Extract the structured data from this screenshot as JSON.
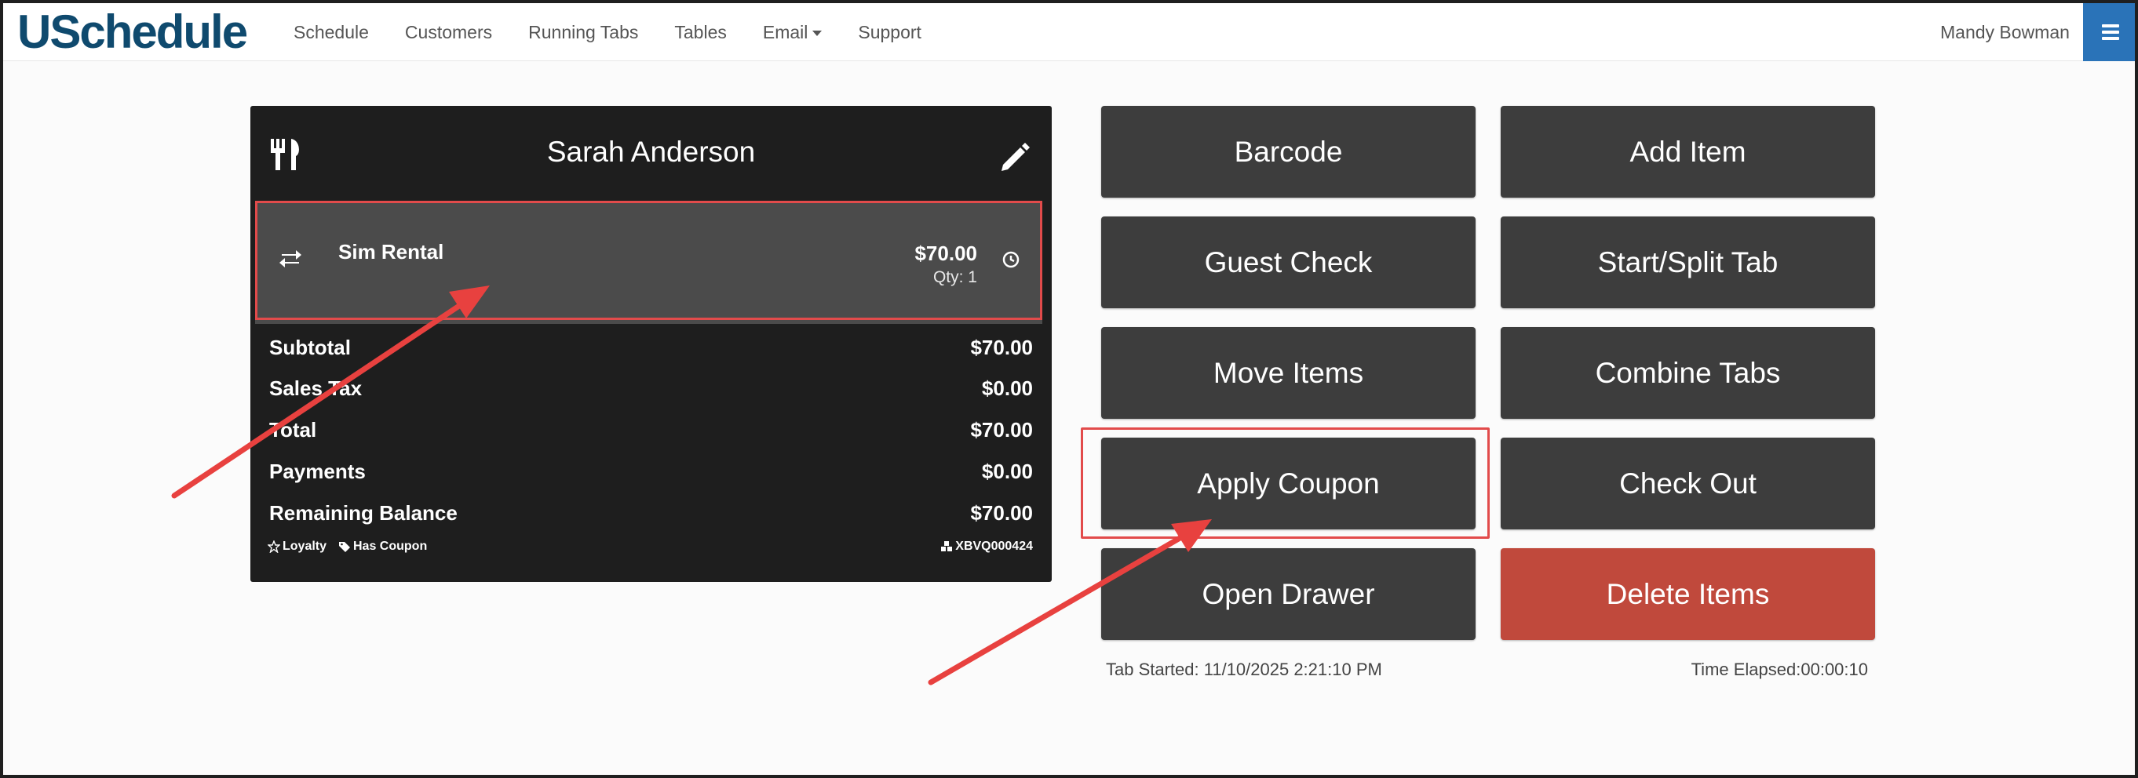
{
  "navbar": {
    "brand": "USchedule",
    "links": [
      "Schedule",
      "Customers",
      "Running Tabs",
      "Tables",
      "Email",
      "Support"
    ],
    "user": "Mandy Bowman"
  },
  "tab": {
    "customer": "Sarah Anderson",
    "item": {
      "name": "Sim Rental",
      "price": "$70.00",
      "qty": "Qty: 1"
    },
    "summary": [
      {
        "label": "Subtotal",
        "value": "$70.00"
      },
      {
        "label": "Sales Tax",
        "value": "$0.00"
      },
      {
        "label": "Total",
        "value": "$70.00"
      },
      {
        "label": "Payments",
        "value": "$0.00"
      },
      {
        "label": "Remaining Balance",
        "value": "$70.00"
      }
    ],
    "tags": {
      "loyalty": "Loyalty",
      "coupon": "Has Coupon",
      "code": "XBVQ000424"
    }
  },
  "actions": {
    "barcode": "Barcode",
    "add_item": "Add Item",
    "guest_check": "Guest Check",
    "start_split": "Start/Split Tab",
    "move_items": "Move Items",
    "combine_tabs": "Combine Tabs",
    "apply_coupon": "Apply Coupon",
    "check_out": "Check Out",
    "open_drawer": "Open Drawer",
    "delete_items": "Delete Items"
  },
  "footer": {
    "started": "Tab Started: 11/10/2025 2:21:10 PM",
    "elapsed": "Time Elapsed:00:00:10"
  },
  "colors": {
    "brand": "#0f4a6e",
    "button": "#3d3d3d",
    "danger": "#c0493c",
    "highlight": "#e24b4b",
    "menu": "#2a73b8"
  }
}
